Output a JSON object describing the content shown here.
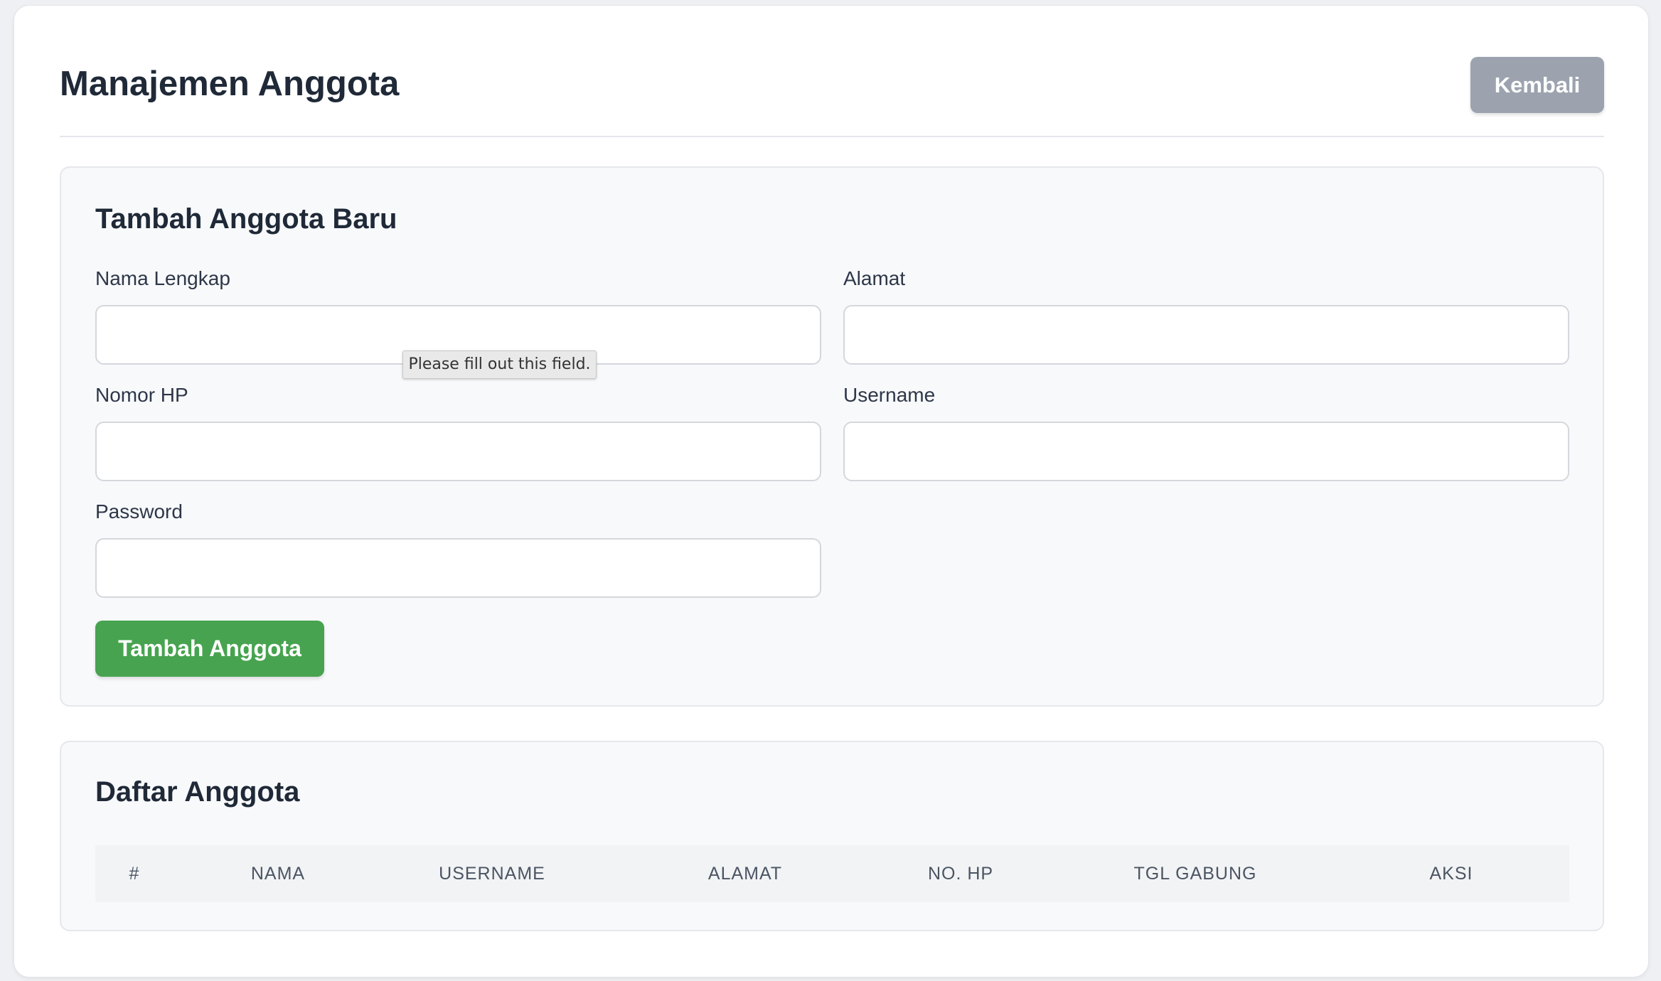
{
  "header": {
    "title": "Manajemen Anggota",
    "back_label": "Kembali"
  },
  "form": {
    "title": "Tambah Anggota Baru",
    "fields": {
      "nama": {
        "label": "Nama Lengkap",
        "value": "",
        "placeholder": ""
      },
      "alamat": {
        "label": "Alamat",
        "value": "",
        "placeholder": ""
      },
      "hp": {
        "label": "Nomor HP",
        "value": "",
        "placeholder": ""
      },
      "username": {
        "label": "Username",
        "value": "",
        "placeholder": ""
      },
      "password": {
        "label": "Password",
        "value": "",
        "placeholder": ""
      }
    },
    "validation_tooltip": "Please fill out this field.",
    "submit_label": "Tambah Anggota"
  },
  "list": {
    "title": "Daftar Anggota",
    "columns": [
      "#",
      "Nama",
      "Username",
      "Alamat",
      "No. HP",
      "Tgl Gabung",
      "Aksi"
    ],
    "rows": []
  },
  "colors": {
    "primary_green": "#47a34f",
    "secondary_gray": "#9ca3af",
    "panel_bg": "#f8f9fb",
    "text_dark": "#1f2937"
  }
}
